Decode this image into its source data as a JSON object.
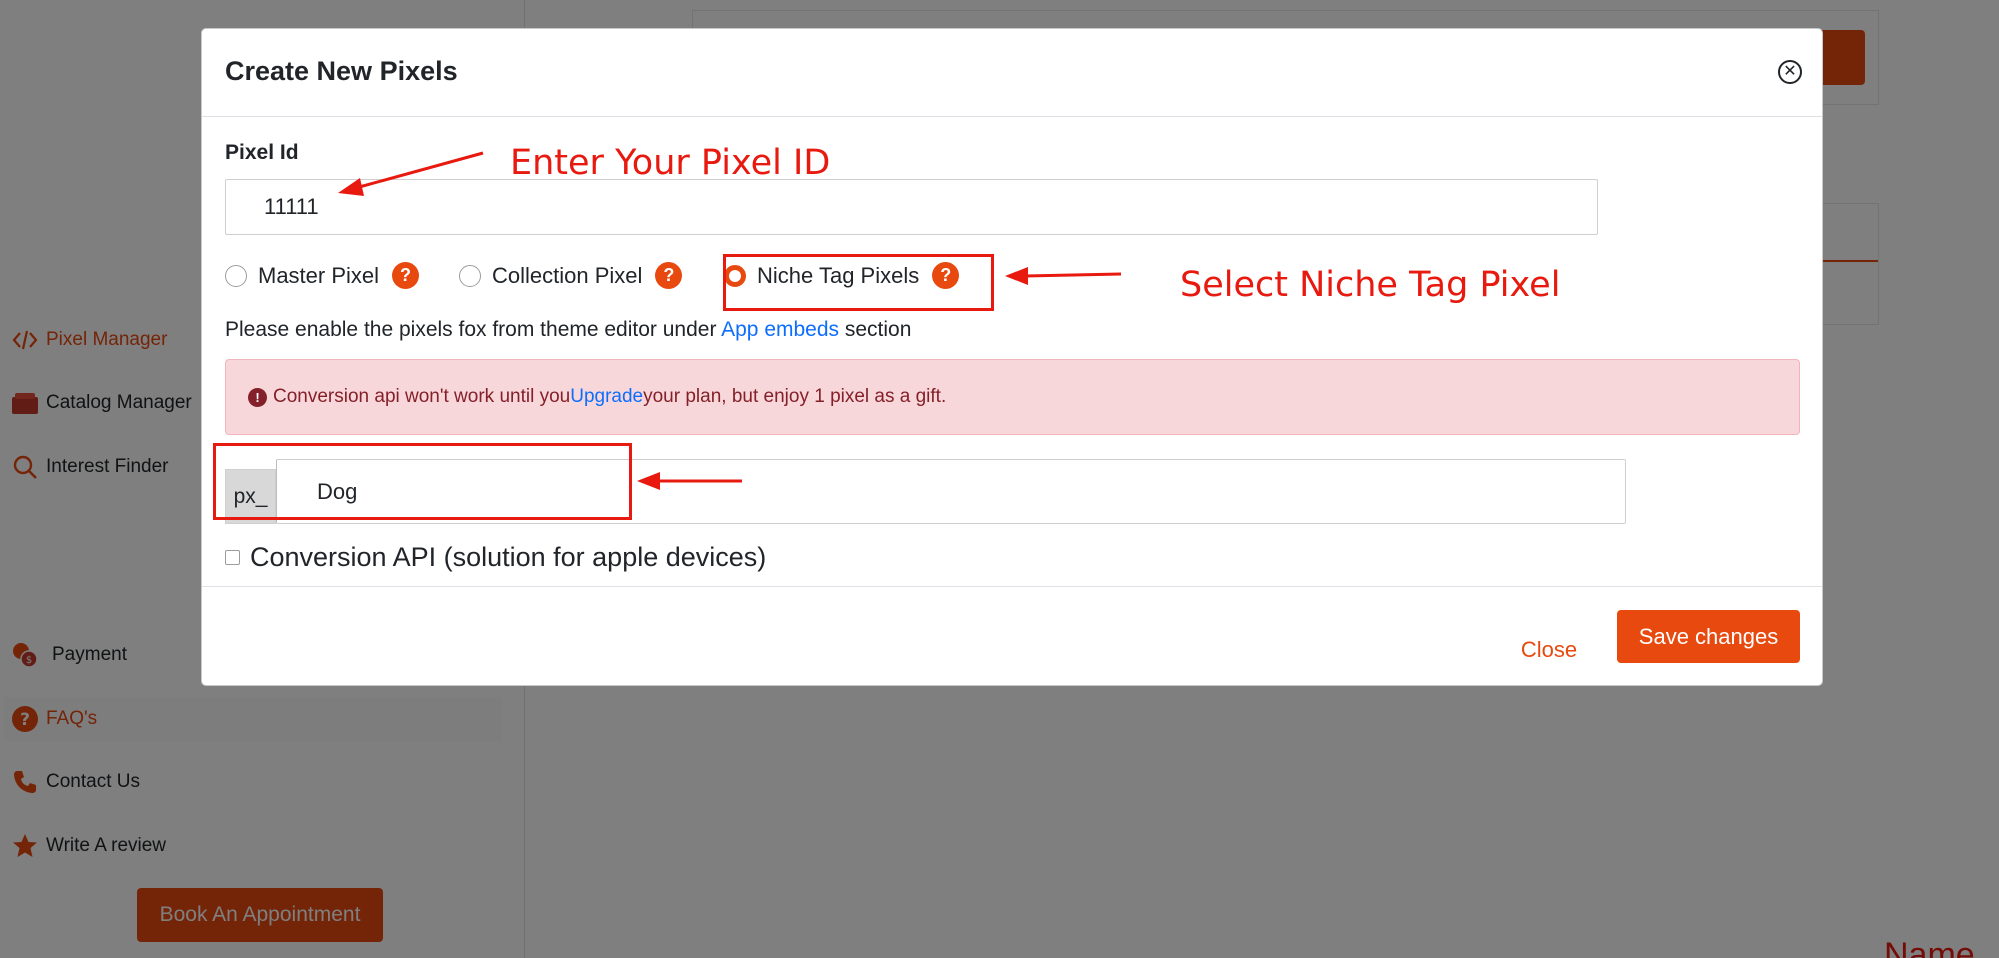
{
  "sidebar": {
    "items": [
      {
        "label": "Pixel Manager",
        "icon": "code-icon",
        "active": true
      },
      {
        "label": "Catalog Manager",
        "icon": "folder-icon"
      },
      {
        "label": "Interest Finder",
        "icon": "search-icon"
      },
      {
        "label": "Payment",
        "icon": "coins-icon"
      },
      {
        "label": "FAQ's",
        "icon": "question-icon"
      },
      {
        "label": "Contact Us",
        "icon": "phone-icon"
      },
      {
        "label": "Write A review",
        "icon": "star-icon"
      }
    ],
    "book_button": "Book An Appointment"
  },
  "modal": {
    "title": "Create New Pixels",
    "pixel_id_label": "Pixel Id",
    "pixel_id_value": "11111",
    "radios": [
      {
        "label": "Master Pixel",
        "checked": false
      },
      {
        "label": "Collection Pixel",
        "checked": false
      },
      {
        "label": "Niche Tag Pixels",
        "checked": true
      }
    ],
    "help_badge": "?",
    "hint_before": "Please enable the pixels fox from theme editor under ",
    "hint_link": "App embeds",
    "hint_after": " section",
    "alert_before": "Conversion api won't work until you ",
    "alert_link": "Upgrade",
    "alert_after": " your plan, but enjoy 1 pixel as a gift.",
    "prefix": "px_",
    "name_value": "Dog",
    "checkbox_label": "Conversion API (solution for apple devices)",
    "close_label": "Close",
    "save_label": "Save changes"
  },
  "annotations": {
    "pixel_id": "Enter Your Pixel ID",
    "niche": "Select Niche Tag Pixel"
  },
  "corner_text": "Name",
  "colors": {
    "accent": "#e8490f",
    "annotation": "#e8190f",
    "link": "#0d6efd",
    "alert_bg": "#f8d7da",
    "alert_text": "#842029"
  }
}
